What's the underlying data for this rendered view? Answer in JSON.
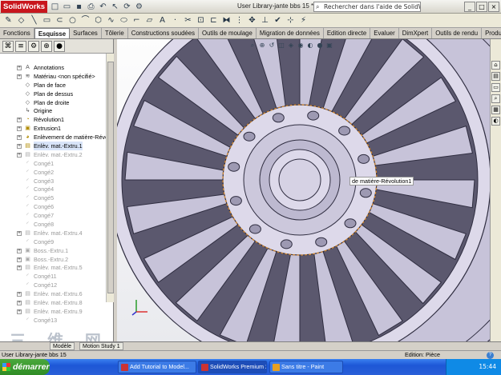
{
  "app": {
    "logo": "SolidWorks",
    "title": "User Library-jante bbs 15 *",
    "search_placeholder": "Rechercher dans l'aide de SolidWorks",
    "window_controls": [
      "_",
      "□",
      "×"
    ]
  },
  "command_tabs": [
    "Fonctions",
    "Esquisse",
    "Surfaces",
    "Tôlerie",
    "Constructions soudées",
    "Outils de moulage",
    "Migration de données",
    "Edition directe",
    "Evaluer",
    "DimXpert",
    "Outils de rendu",
    "Produt"
  ],
  "active_command_tab": "Esquisse",
  "feature_tree": [
    {
      "label": "Annotations",
      "icon": "annotation-icon",
      "state": "normal"
    },
    {
      "label": "Matériau <non spécifié>",
      "icon": "material-icon",
      "state": "normal"
    },
    {
      "label": "Plan de face",
      "icon": "plane-icon",
      "state": "normal"
    },
    {
      "label": "Plan de dessus",
      "icon": "plane-icon",
      "state": "normal"
    },
    {
      "label": "Plan de droite",
      "icon": "plane-icon",
      "state": "normal"
    },
    {
      "label": "Origine",
      "icon": "origin-icon",
      "state": "normal"
    },
    {
      "label": "Révolution1",
      "icon": "revolve-icon",
      "state": "normal"
    },
    {
      "label": "Extrusion1",
      "icon": "extrude-icon",
      "state": "normal"
    },
    {
      "label": "Enlèvement de matière-Révolut",
      "icon": "cut-revolve-icon",
      "state": "normal"
    },
    {
      "label": "Enlèv. mat.-Extru.1",
      "icon": "cut-extrude-icon",
      "state": "selected"
    },
    {
      "label": "Enlèv. mat.-Extru.2",
      "icon": "cut-extrude-icon",
      "state": "dim"
    },
    {
      "label": "Congé1",
      "icon": "fillet-icon",
      "state": "dim"
    },
    {
      "label": "Congé2",
      "icon": "fillet-icon",
      "state": "dim"
    },
    {
      "label": "Congé3",
      "icon": "fillet-icon",
      "state": "dim"
    },
    {
      "label": "Congé4",
      "icon": "fillet-icon",
      "state": "dim"
    },
    {
      "label": "Congé5",
      "icon": "fillet-icon",
      "state": "dim"
    },
    {
      "label": "Congé6",
      "icon": "fillet-icon",
      "state": "dim"
    },
    {
      "label": "Congé7",
      "icon": "fillet-icon",
      "state": "dim"
    },
    {
      "label": "Congé8",
      "icon": "fillet-icon",
      "state": "dim"
    },
    {
      "label": "Enlèv. mat.-Extru.4",
      "icon": "cut-extrude-icon",
      "state": "dim"
    },
    {
      "label": "Congé9",
      "icon": "fillet-icon",
      "state": "dim"
    },
    {
      "label": "Boss.-Extru.1",
      "icon": "extrude-icon",
      "state": "dim"
    },
    {
      "label": "Boss.-Extru.2",
      "icon": "extrude-icon",
      "state": "dim"
    },
    {
      "label": "Enlèv. mat.-Extru.5",
      "icon": "cut-extrude-icon",
      "state": "dim"
    },
    {
      "label": "Congé11",
      "icon": "fillet-icon",
      "state": "dim"
    },
    {
      "label": "Congé12",
      "icon": "fillet-icon",
      "state": "dim"
    },
    {
      "label": "Enlèv. mat.-Extru.6",
      "icon": "cut-extrude-icon",
      "state": "dim"
    },
    {
      "label": "Enlèv. mat.-Extru.8",
      "icon": "cut-extrude-icon",
      "state": "dim"
    },
    {
      "label": "Enlèv. mat.-Extru.9",
      "icon": "cut-extrude-icon",
      "state": "dim"
    },
    {
      "label": "Congé13",
      "icon": "fillet-icon",
      "state": "dim"
    }
  ],
  "bottom_tabs": [
    "Modèle",
    "Motion Study 1"
  ],
  "tooltip": "de matière-Révolution1",
  "status": {
    "left": "User Library-jante bbs 15",
    "right": "Edition: Pièce",
    "help": "?"
  },
  "taskbar": {
    "start": "démarrer",
    "buttons": [
      "Add Tutorial to Model...",
      "SolidWorks Premium 2...",
      "Sans titre - Paint"
    ],
    "clock": "15:44"
  },
  "watermark": "三 维 网",
  "colors": {
    "rim_fill": "#c7c3d9",
    "rim_light": "#ddd9ea",
    "rim_stroke": "#2f2d40",
    "brand_red": "#c8161d",
    "taskbar_blue": "#245edb"
  }
}
